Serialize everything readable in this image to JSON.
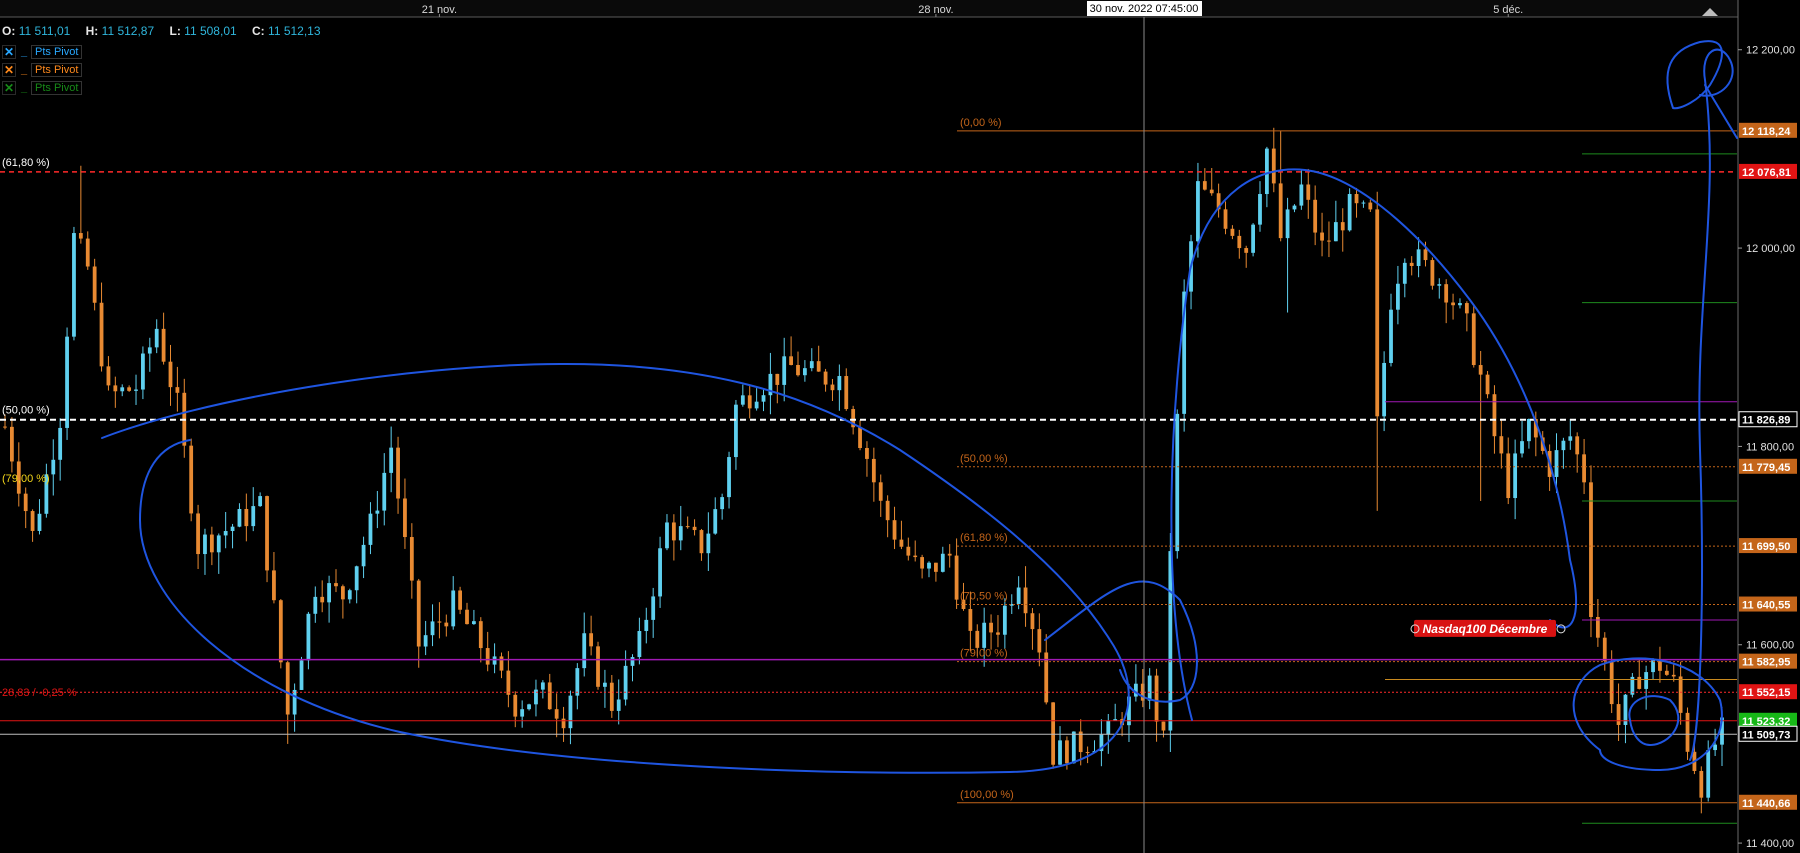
{
  "ohlc": {
    "o_label": "O:",
    "o": "11 511,01",
    "h_label": "H:",
    "h": "11 512,87",
    "l_label": "L:",
    "l": "11 508,01",
    "c_label": "C:",
    "c": "11 512,13"
  },
  "legend": [
    {
      "icon": "close-icon",
      "mark": "_",
      "label": "Pts Pivot",
      "color": "#29a8ff"
    },
    {
      "icon": "close-icon",
      "mark": "_",
      "label": "Pts Pivot",
      "color": "#ff8a1d"
    },
    {
      "icon": "close-icon",
      "mark": "_",
      "label": "Pts Pivot",
      "color": "#178a18"
    }
  ],
  "crosshair_date": "30 nov. 2022 07:45:00",
  "colors": {
    "background": "#000000",
    "up_candle": "#5fd0ef",
    "down_candle": "#e88a32",
    "annotation_blue": "#1f55e0",
    "fib_line": "#c4651a",
    "resistance_red": "#ff2a2a",
    "support_white": "#ffffff",
    "pivot_purple": "#a019b4",
    "pivot_green": "#1e8a1e"
  },
  "chart_data": {
    "type": "candlestick",
    "instrument": "Nasdaq100 Décembre",
    "x_axis": {
      "ticks": [
        {
          "label": "21 nov.",
          "index": 63
        },
        {
          "label": "28 nov.",
          "index": 135
        },
        {
          "label": "5 déc.",
          "index": 218
        }
      ]
    },
    "y_axis": {
      "ylim": [
        11390,
        12232
      ],
      "ticks": [
        "11 400,00",
        "11 600,00",
        "11 800,00",
        "12 000,00",
        "12 200,00"
      ],
      "tick_values": [
        11400,
        11600,
        11800,
        12000,
        12200
      ]
    },
    "price_labels": [
      {
        "value": 12118.24,
        "text": "12 118,24",
        "bg": "#c4651a",
        "fg": "#ffffff"
      },
      {
        "value": 12076.81,
        "text": "12 076,81",
        "bg": "#e11414",
        "fg": "#ffffff"
      },
      {
        "value": 11826.89,
        "text": "11 826,89",
        "bg": "#000000",
        "fg": "#ffffff",
        "border": "#ffffff"
      },
      {
        "value": 11779.45,
        "text": "11 779,45",
        "bg": "#c4651a",
        "fg": "#ffffff"
      },
      {
        "value": 11699.5,
        "text": "11 699,50",
        "bg": "#c4651a",
        "fg": "#ffffff"
      },
      {
        "value": 11640.55,
        "text": "11 640,55",
        "bg": "#c4651a",
        "fg": "#ffffff"
      },
      {
        "value": 11582.95,
        "text": "11 582,95",
        "bg": "#c4651a",
        "fg": "#ffffff"
      },
      {
        "value": 11552.15,
        "text": "11 552,15",
        "bg": "#e11414",
        "fg": "#ffffff"
      },
      {
        "value": 11523.32,
        "text": "11 523,32",
        "bg": "#17b817",
        "fg": "#ffffff"
      },
      {
        "value": 11509.73,
        "text": "11 509,73",
        "bg": "#000000",
        "fg": "#ffffff",
        "border": "#ffffff"
      },
      {
        "value": 11440.66,
        "text": "11 440,66",
        "bg": "#c4651a",
        "fg": "#ffffff"
      }
    ],
    "fib_levels": [
      {
        "label": "(0,00 %)",
        "value": 12118.24
      },
      {
        "label": "(50,00 %)",
        "value": 11779.45
      },
      {
        "label": "(61,80 %)",
        "value": 11699.5
      },
      {
        "label": "(70,50 %)",
        "value": 11640.55
      },
      {
        "label": "(79,00 %)",
        "value": 11582.95
      },
      {
        "label": "(100,00 %)",
        "value": 11440.66
      }
    ],
    "left_fib_labels": [
      {
        "label": "(61,80 %)",
        "value": 12076.81,
        "color": "#ffffff"
      },
      {
        "label": "(50,00 %)",
        "value": 11826.89,
        "color": "#ffffff"
      },
      {
        "label": "(79,00 %)",
        "value": 11758,
        "color": "#f2d51a"
      }
    ],
    "red_dotted_label": "28,83 / -0,25 %",
    "annotation_label": "Nasdaq100 Décembre",
    "anchors": [
      {
        "i": 0,
        "v": 11820
      },
      {
        "i": 4,
        "v": 11710
      },
      {
        "i": 8,
        "v": 11830
      },
      {
        "i": 10,
        "v": 12010
      },
      {
        "i": 12,
        "v": 11980
      },
      {
        "i": 15,
        "v": 11850
      },
      {
        "i": 19,
        "v": 11860
      },
      {
        "i": 22,
        "v": 11920
      },
      {
        "i": 25,
        "v": 11840
      },
      {
        "i": 28,
        "v": 11700
      },
      {
        "i": 33,
        "v": 11720
      },
      {
        "i": 37,
        "v": 11740
      },
      {
        "i": 41,
        "v": 11530
      },
      {
        "i": 45,
        "v": 11660
      },
      {
        "i": 49,
        "v": 11650
      },
      {
        "i": 53,
        "v": 11720
      },
      {
        "i": 56,
        "v": 11800
      },
      {
        "i": 60,
        "v": 11600
      },
      {
        "i": 65,
        "v": 11640
      },
      {
        "i": 69,
        "v": 11600
      },
      {
        "i": 74,
        "v": 11540
      },
      {
        "i": 78,
        "v": 11550
      },
      {
        "i": 81,
        "v": 11530
      },
      {
        "i": 84,
        "v": 11600
      },
      {
        "i": 88,
        "v": 11540
      },
      {
        "i": 92,
        "v": 11600
      },
      {
        "i": 96,
        "v": 11720
      },
      {
        "i": 101,
        "v": 11700
      },
      {
        "i": 104,
        "v": 11750
      },
      {
        "i": 106,
        "v": 11840
      },
      {
        "i": 109,
        "v": 11860
      },
      {
        "i": 114,
        "v": 11880
      },
      {
        "i": 118,
        "v": 11870
      },
      {
        "i": 121,
        "v": 11870
      },
      {
        "i": 125,
        "v": 11790
      },
      {
        "i": 127,
        "v": 11740
      },
      {
        "i": 130,
        "v": 11700
      },
      {
        "i": 133,
        "v": 11670
      },
      {
        "i": 137,
        "v": 11690
      },
      {
        "i": 140,
        "v": 11600
      },
      {
        "i": 144,
        "v": 11620
      },
      {
        "i": 147,
        "v": 11670
      },
      {
        "i": 150,
        "v": 11600
      },
      {
        "i": 152,
        "v": 11490
      },
      {
        "i": 156,
        "v": 11500
      },
      {
        "i": 160,
        "v": 11510
      },
      {
        "i": 163,
        "v": 11540
      },
      {
        "i": 166,
        "v": 11560
      },
      {
        "i": 168,
        "v": 11500
      },
      {
        "i": 169,
        "v": 11700
      },
      {
        "i": 171,
        "v": 11950
      },
      {
        "i": 173,
        "v": 12060
      },
      {
        "i": 176,
        "v": 12040
      },
      {
        "i": 180,
        "v": 12000
      },
      {
        "i": 183,
        "v": 12100
      },
      {
        "i": 185,
        "v": 12010
      },
      {
        "i": 188,
        "v": 12060
      },
      {
        "i": 191,
        "v": 12000
      },
      {
        "i": 195,
        "v": 12040
      },
      {
        "i": 198,
        "v": 12030
      },
      {
        "i": 199,
        "v": 11820
      },
      {
        "i": 201,
        "v": 11950
      },
      {
        "i": 203,
        "v": 12000
      },
      {
        "i": 206,
        "v": 11980
      },
      {
        "i": 209,
        "v": 11960
      },
      {
        "i": 212,
        "v": 11920
      },
      {
        "i": 214,
        "v": 11870
      },
      {
        "i": 216,
        "v": 11810
      },
      {
        "i": 218,
        "v": 11760
      },
      {
        "i": 221,
        "v": 11820
      },
      {
        "i": 224,
        "v": 11780
      },
      {
        "i": 227,
        "v": 11810
      },
      {
        "i": 229,
        "v": 11770
      },
      {
        "i": 230,
        "v": 11640
      },
      {
        "i": 232,
        "v": 11580
      },
      {
        "i": 234,
        "v": 11520
      },
      {
        "i": 237,
        "v": 11570
      },
      {
        "i": 240,
        "v": 11580
      },
      {
        "i": 242,
        "v": 11560
      },
      {
        "i": 244,
        "v": 11500
      },
      {
        "i": 246,
        "v": 11460
      },
      {
        "i": 248,
        "v": 11500
      },
      {
        "i": 249,
        "v": 11512
      }
    ],
    "candle_count": 250,
    "last_price": 11512.13
  }
}
